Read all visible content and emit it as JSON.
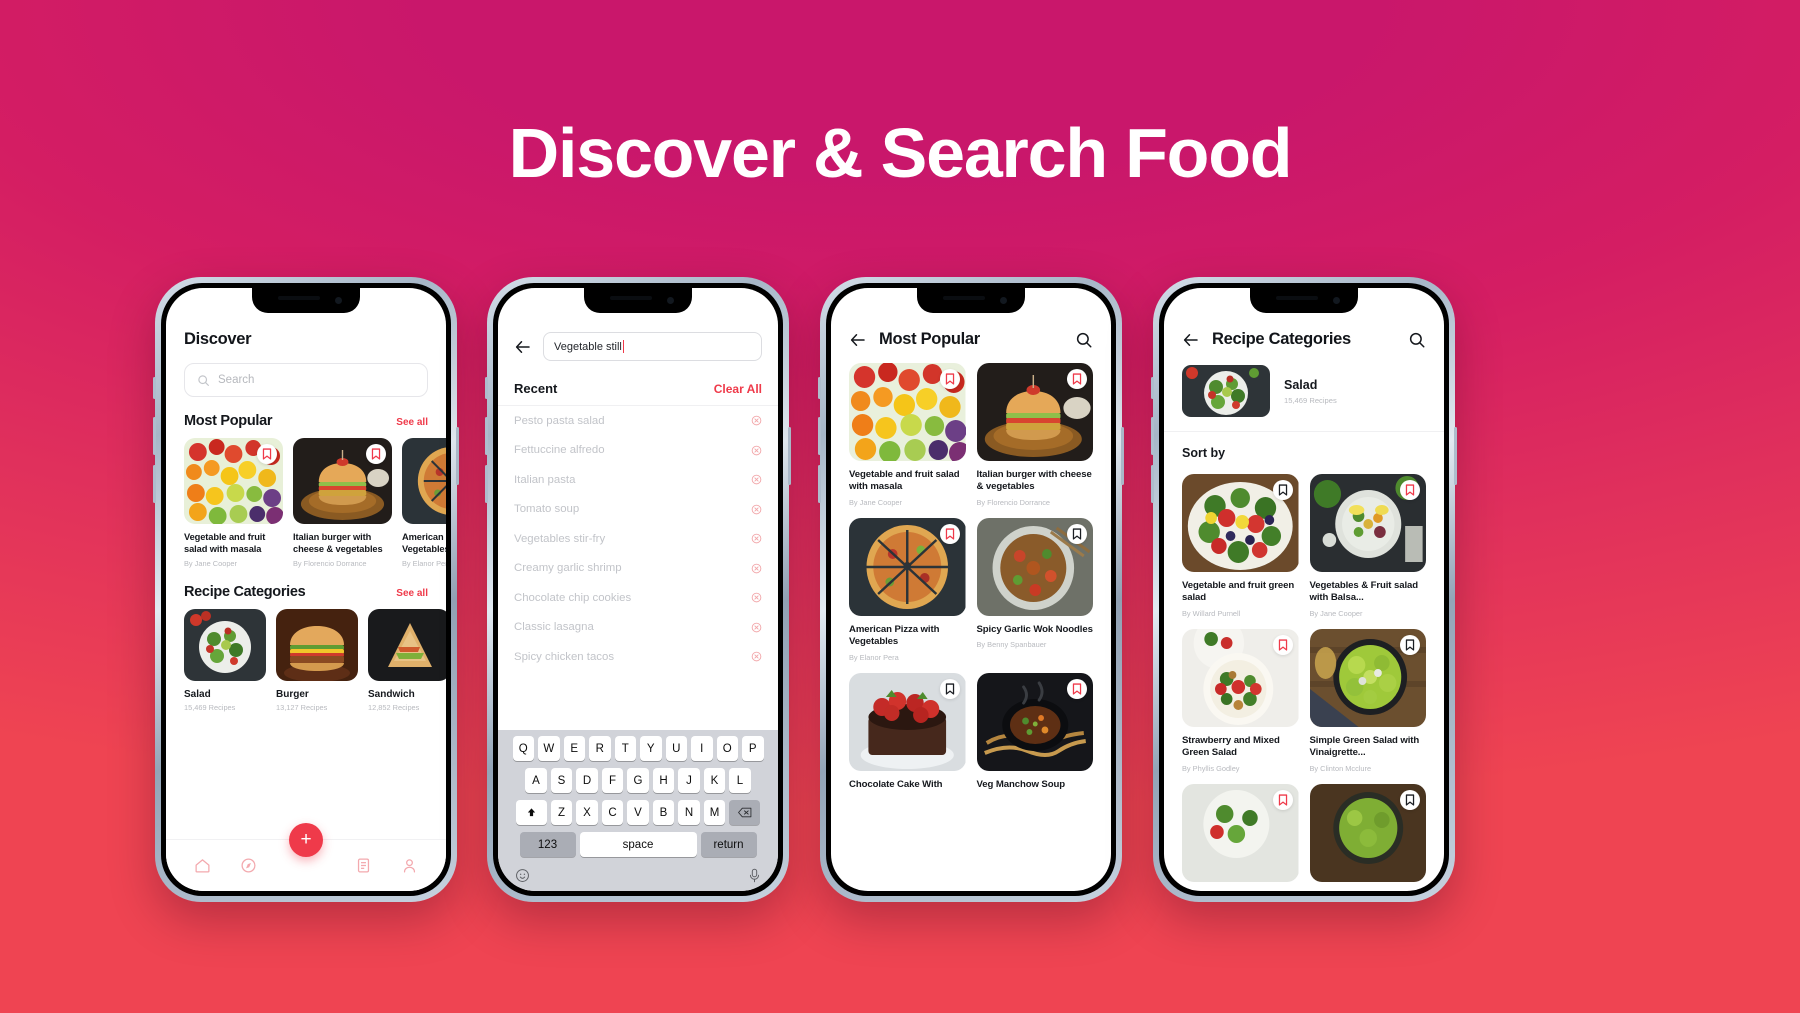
{
  "hero": {
    "title": "Discover & Search Food"
  },
  "theme": {
    "accent": "#ef3a4a",
    "bg_top": "#c9176b",
    "bg_bottom": "#ef4452",
    "title_color": "#ffffff"
  },
  "phone1": {
    "title": "Discover",
    "search": {
      "placeholder": "Search",
      "icon": "search-icon"
    },
    "most_popular": {
      "heading": "Most Popular",
      "see_all": "See all"
    },
    "popular_cards": [
      {
        "title": "Vegetable and fruit salad with masala",
        "author": "By Jane Cooper",
        "bookmarked": true
      },
      {
        "title": "Italian burger with cheese & vegetables",
        "author": "By Florencio Dorrance",
        "bookmarked": true
      },
      {
        "title": "American Pizza with Vegetables",
        "author": "By Elanor Pera",
        "bookmarked": true
      }
    ],
    "recipe_categories": {
      "heading": "Recipe Categories",
      "see_all": "See all"
    },
    "categories": [
      {
        "name": "Salad",
        "count": "15,469 Recipes"
      },
      {
        "name": "Burger",
        "count": "13,127 Recipes"
      },
      {
        "name": "Sandwich",
        "count": "12,852 Recipes"
      }
    ],
    "fab": "+",
    "tabs": [
      {
        "name": "home-tab",
        "icon": "home-icon"
      },
      {
        "name": "explore-tab",
        "icon": "compass-icon"
      },
      {
        "name": "list-tab",
        "icon": "list-icon"
      },
      {
        "name": "profile-tab",
        "icon": "person-icon"
      }
    ]
  },
  "phone2": {
    "back_icon": "back-arrow-icon",
    "search_value": "Vegetable still",
    "recent_label": "Recent",
    "clear_all": "Clear All",
    "recent_items": [
      "Pesto pasta salad",
      "Fettuccine alfredo",
      "Italian pasta",
      "Tomato soup",
      "Vegetables stir-fry",
      "Creamy garlic shrimp",
      "Chocolate chip cookies",
      "Classic lasagna",
      "Spicy chicken tacos"
    ],
    "keyboard": {
      "row1": [
        "Q",
        "W",
        "E",
        "R",
        "T",
        "Y",
        "U",
        "I",
        "O",
        "P"
      ],
      "row2": [
        "A",
        "S",
        "D",
        "F",
        "G",
        "H",
        "J",
        "K",
        "L"
      ],
      "row3": [
        "Z",
        "X",
        "C",
        "V",
        "B",
        "N",
        "M"
      ],
      "shift": "⇧",
      "backspace": "⌫",
      "numbers": "123",
      "space": "space",
      "return": "return",
      "emoji": "emoji-icon",
      "mic": "mic-icon"
    }
  },
  "phone3": {
    "title": "Most Popular",
    "back_icon": "back-arrow-icon",
    "search_icon": "search-icon",
    "cards": [
      {
        "title": "Vegetable and fruit salad with masala",
        "author": "By Jane Cooper",
        "bookmark": "red"
      },
      {
        "title": "Italian burger with cheese & vegetables",
        "author": "By Florencio Dorrance",
        "bookmark": "red"
      },
      {
        "title": "American Pizza with Vegetables",
        "author": "By Elanor Pera",
        "bookmark": "red"
      },
      {
        "title": "Spicy Garlic Wok Noodles",
        "author": "By Benny Spanbauer",
        "bookmark": "dark"
      },
      {
        "title": "Chocolate Cake With",
        "author": "",
        "bookmark": "dark"
      },
      {
        "title": "Veg Manchow Soup",
        "author": "",
        "bookmark": "red"
      }
    ]
  },
  "phone4": {
    "title": "Recipe Categories",
    "back_icon": "back-arrow-icon",
    "search_icon": "search-icon",
    "hero": {
      "name": "Salad",
      "count": "15,469 Recipes"
    },
    "sort_by": "Sort by",
    "cards": [
      {
        "title": "Vegetable and fruit green salad",
        "author": "By Willard Purnell",
        "bookmark": "dark"
      },
      {
        "title": "Vegetables & Fruit salad with Balsa...",
        "author": "By Jane Cooper",
        "bookmark": "red"
      },
      {
        "title": "Strawberry and Mixed Green Salad",
        "author": "By Phyllis Godley",
        "bookmark": "red"
      },
      {
        "title": "Simple Green Salad with Vinaigrette...",
        "author": "By Clinton Mcclure",
        "bookmark": "dark"
      },
      {
        "title": "",
        "author": "",
        "bookmark": "red"
      },
      {
        "title": "",
        "author": "",
        "bookmark": "dark"
      }
    ]
  }
}
